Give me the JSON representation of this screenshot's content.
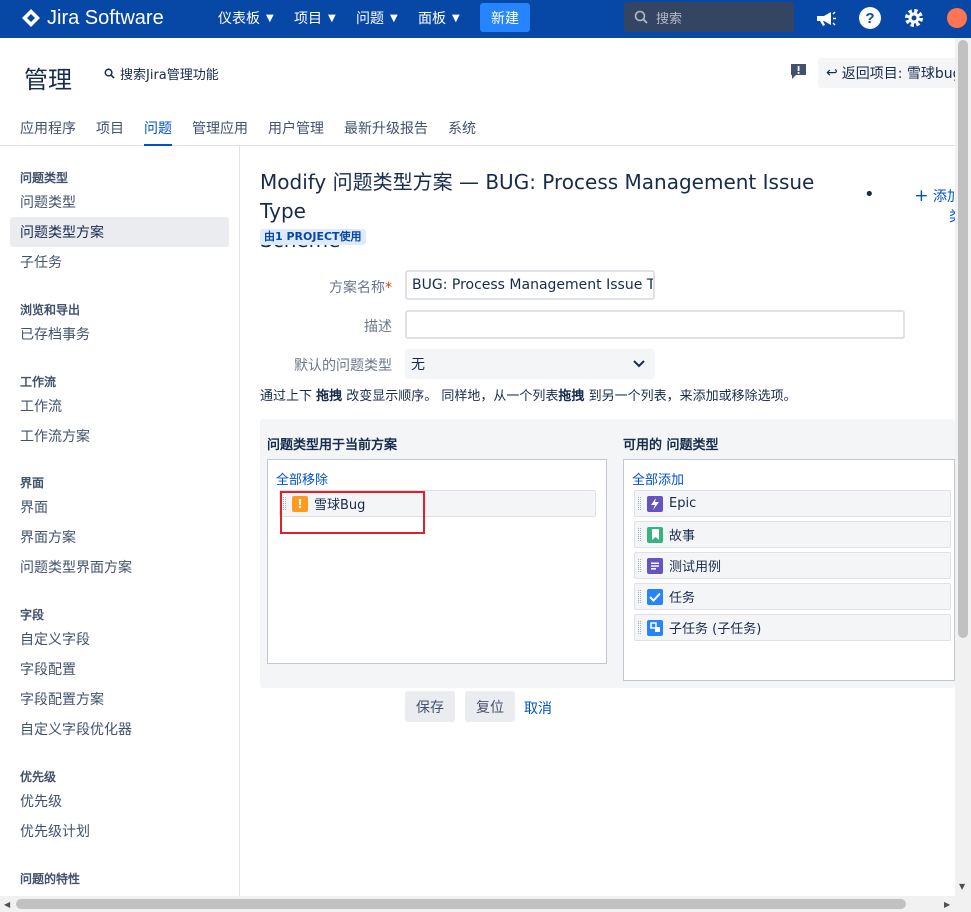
{
  "topnav": {
    "brand": "Jira Software",
    "menu": [
      {
        "label": "仪表板"
      },
      {
        "label": "项目"
      },
      {
        "label": "问题"
      },
      {
        "label": "面板"
      }
    ],
    "create_label": "新建",
    "search_placeholder": "搜索"
  },
  "admin": {
    "title": "管理",
    "search_label": "搜索Jira管理功能",
    "back_label": "返回项目: 雪球bug"
  },
  "tabs": [
    "应用程序",
    "项目",
    "问题",
    "管理应用",
    "用户管理",
    "最新升级报告",
    "系统"
  ],
  "sidebar": {
    "sections": [
      {
        "heading": "问题类型",
        "items": [
          "问题类型",
          "问题类型方案",
          "子任务"
        ]
      },
      {
        "heading": "浏览和导出",
        "items": [
          "已存档事务"
        ]
      },
      {
        "heading": "工作流",
        "items": [
          "工作流",
          "工作流方案"
        ]
      },
      {
        "heading": "界面",
        "items": [
          "界面",
          "界面方案",
          "问题类型界面方案"
        ]
      },
      {
        "heading": "字段",
        "items": [
          "自定义字段",
          "字段配置",
          "字段配置方案",
          "自定义字段优化器"
        ]
      },
      {
        "heading": "优先级",
        "items": [
          "优先级",
          "优先级计划"
        ]
      },
      {
        "heading": "问题的特性",
        "items": []
      }
    ]
  },
  "main": {
    "heading_line1": "Modify 问题类型方案 — BUG: Process Management Issue Type",
    "heading_line2": "Scheme",
    "used_badge": "由1 PROJECT使用",
    "add_link_line1": "添加问",
    "add_link_line2": "类",
    "form": {
      "name_label": "方案名称",
      "name_required": "*",
      "name_value": "BUG: Process Management Issue Type",
      "desc_label": "描述",
      "desc_value": "",
      "default_label": "默认的问题类型",
      "default_value": "无"
    },
    "hint": {
      "p1": "通过上下 ",
      "b1": "拖拽",
      "p2": " 改变显示顺序。 同样地，从一个列表",
      "b2": "拖拽",
      "p3": " 到另一个列表，来添加或移除选项。"
    },
    "current": {
      "title": "问题类型用于当前方案",
      "remove_all": "全部移除",
      "items": [
        {
          "label": "雪球Bug",
          "icon": "bug-exclamation-icon",
          "color": "#ff991f"
        }
      ]
    },
    "available": {
      "title": "可用的 问题类型",
      "add_all": "全部添加",
      "items": [
        {
          "label": "Epic",
          "icon": "epic-lightning-icon",
          "color": "#6554c0"
        },
        {
          "label": "故事",
          "icon": "story-bookmark-icon",
          "color": "#36b37e"
        },
        {
          "label": "测试用例",
          "icon": "testcase-lines-icon",
          "color": "#6554c0"
        },
        {
          "label": "任务",
          "icon": "task-check-icon",
          "color": "#2684ff"
        },
        {
          "label": "子任务 (子任务)",
          "icon": "subtask-icon",
          "color": "#2684ff"
        }
      ]
    },
    "buttons": {
      "save": "保存",
      "reset": "复位",
      "cancel": "取消"
    }
  }
}
